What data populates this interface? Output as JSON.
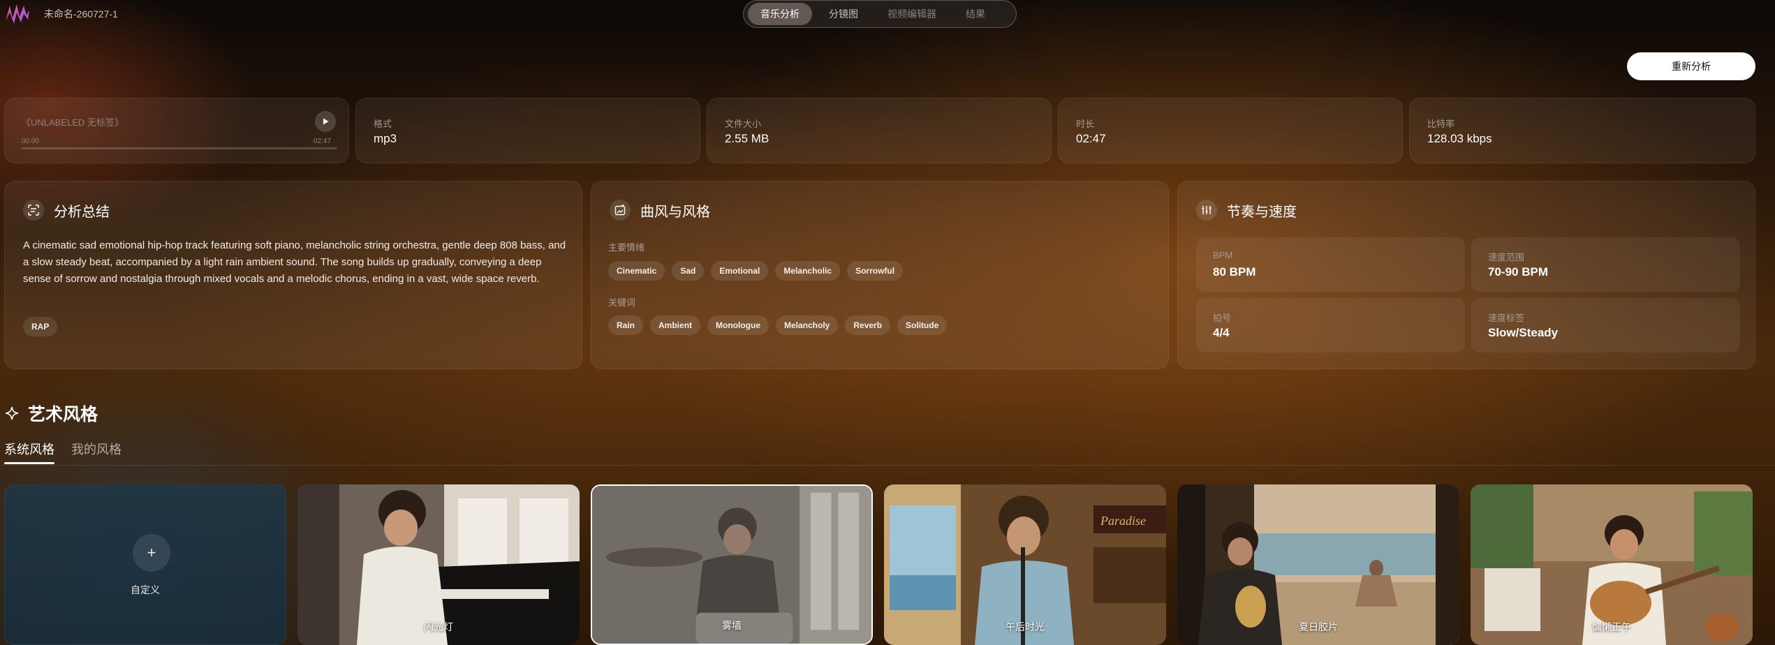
{
  "header": {
    "project_title": "未命名-260727-1",
    "steps": [
      {
        "label": "音乐分析",
        "active": true
      },
      {
        "label": "分镜图",
        "active": false
      },
      {
        "label": "视频编辑器",
        "active": false
      },
      {
        "label": "结果",
        "active": false
      }
    ],
    "reanalyze_label": "重新分析"
  },
  "player": {
    "title": "《UNLABELED 无标签》",
    "current_time": "00:00",
    "total_time": "02:47",
    "progress": 0.0
  },
  "file_info": [
    {
      "label": "格式",
      "value": "mp3"
    },
    {
      "label": "文件大小",
      "value": "2.55 MB"
    },
    {
      "label": "时长",
      "value": "02:47"
    },
    {
      "label": "比特率",
      "value": "128.03 kbps"
    }
  ],
  "summary_panel": {
    "title": "分析总结",
    "text": "A cinematic sad emotional hip-hop track featuring soft piano, melancholic string orchestra, gentle deep 808 bass, and a slow steady beat, accompanied by a light rain ambient sound. The song builds up gradually, conveying a deep sense of sorrow and nostalgia through mixed vocals and a melodic chorus, ending in a vast, wide space reverb.",
    "genre_tag": "RAP"
  },
  "style_panel": {
    "title": "曲风与风格",
    "mood_label": "主要情绪",
    "moods": [
      "Cinematic",
      "Sad",
      "Emotional",
      "Melancholic",
      "Sorrowful"
    ],
    "keywords_label": "关键词",
    "keywords": [
      "Rain",
      "Ambient",
      "Monologue",
      "Melancholy",
      "Reverb",
      "Solitude"
    ]
  },
  "rhythm_panel": {
    "title": "节奏与速度",
    "metrics": [
      {
        "label": "BPM",
        "value": "80 BPM"
      },
      {
        "label": "速度范围",
        "value": "70-90 BPM"
      },
      {
        "label": "拍号",
        "value": "4/4"
      },
      {
        "label": "速度标签",
        "value": "Slow/Steady"
      }
    ]
  },
  "art_style": {
    "title": "艺术风格",
    "tabs": [
      {
        "label": "系统风格",
        "active": true
      },
      {
        "label": "我的风格",
        "active": false
      }
    ],
    "custom_label": "自定义",
    "styles": [
      {
        "caption": "闪光灯",
        "selected": false
      },
      {
        "caption": "雾墙",
        "selected": true
      },
      {
        "caption": "午后时光",
        "selected": false
      },
      {
        "caption": "夏日胶片",
        "selected": false
      },
      {
        "caption": "慵懒正午",
        "selected": false
      }
    ]
  },
  "colors": {
    "accent": "#ffffff",
    "logo_pink": "#e0559c",
    "logo_purple": "#9b5ce0"
  }
}
